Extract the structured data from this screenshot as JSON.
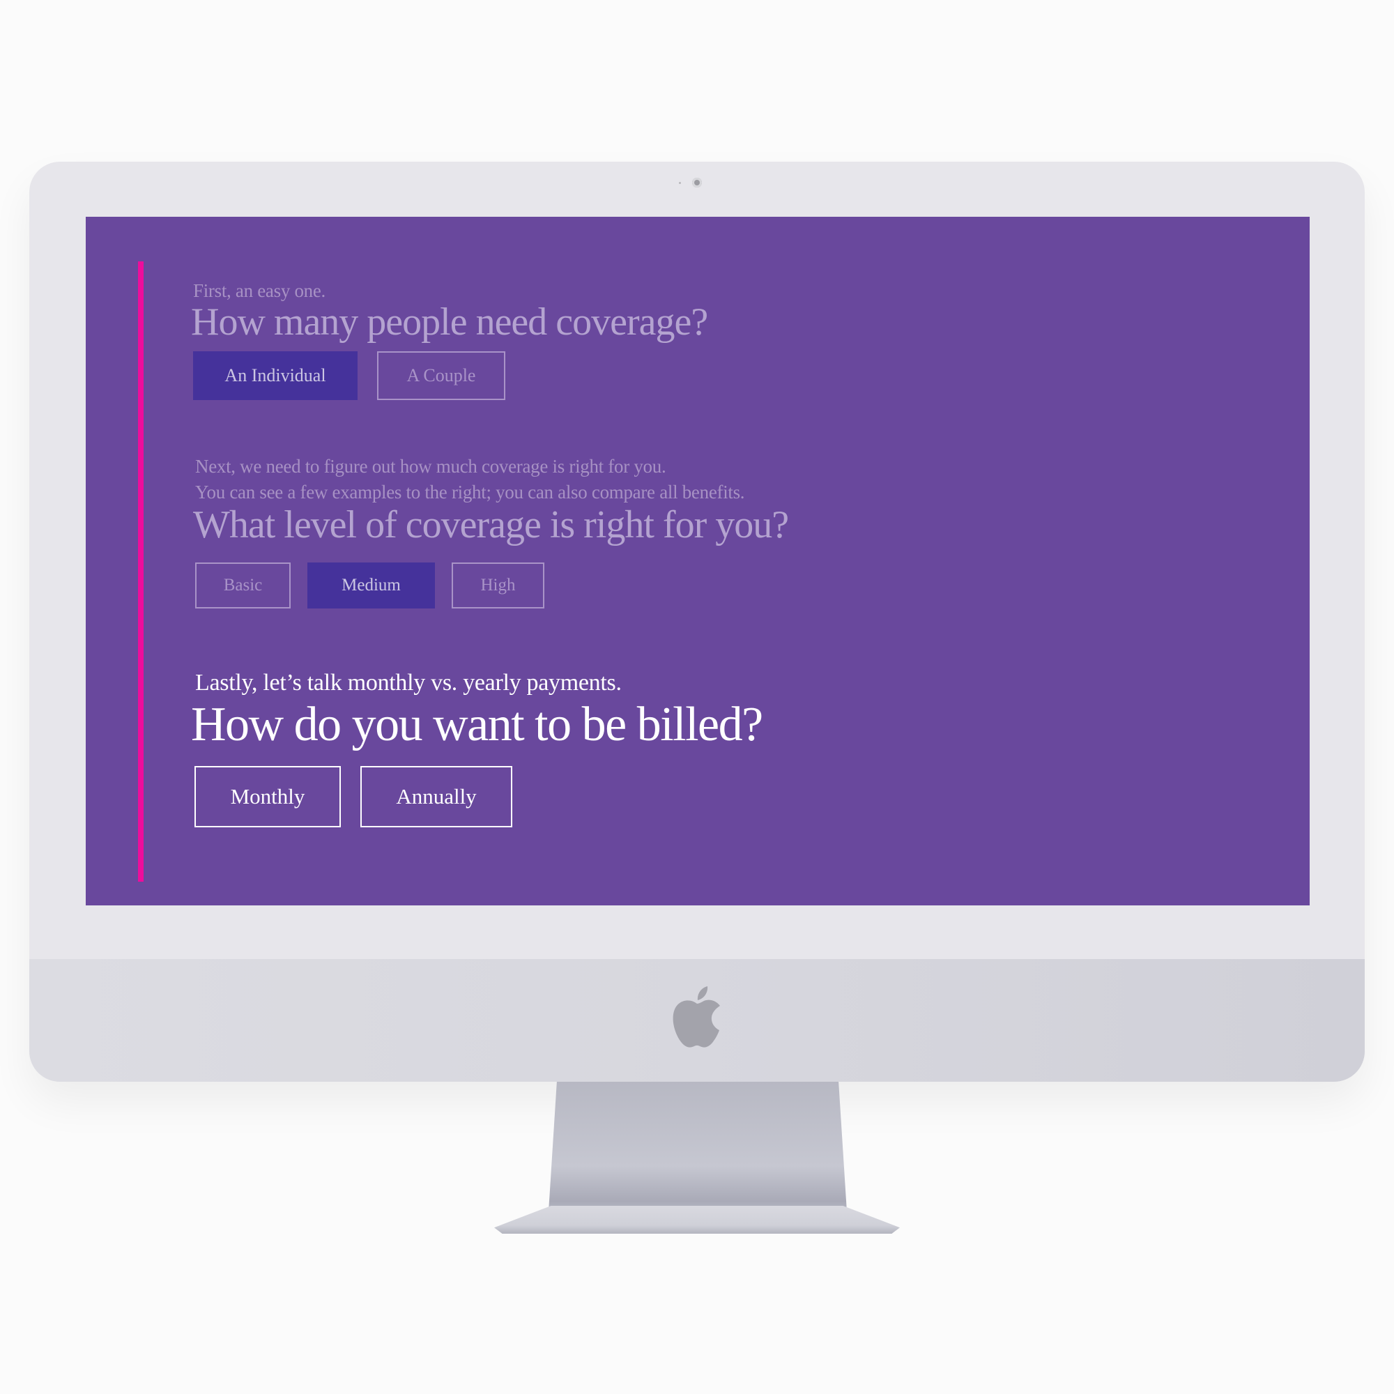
{
  "colors": {
    "screen_background": "#69489d",
    "progress_rail": "#ed0d9c",
    "selected_button": "#45329b",
    "active_text": "#ffffff"
  },
  "questions": [
    {
      "intro": "First, an easy one.",
      "title": "How many people need coverage?",
      "state": "answered",
      "options": [
        {
          "label": "An Individual",
          "selected": true
        },
        {
          "label": "A Couple",
          "selected": false
        }
      ]
    },
    {
      "intro_lines": [
        "Next, we need to figure out how much coverage is right for you.",
        "You can see a few examples to the right; you can also compare all benefits."
      ],
      "title": "What level of coverage is right for you?",
      "state": "answered",
      "options": [
        {
          "label": "Basic",
          "selected": false
        },
        {
          "label": "Medium",
          "selected": true
        },
        {
          "label": "High",
          "selected": false
        }
      ]
    },
    {
      "intro": "Lastly, let’s talk monthly vs. yearly payments.",
      "title": "How do you want to be billed?",
      "state": "active",
      "options": [
        {
          "label": "Monthly",
          "selected": false
        },
        {
          "label": "Annually",
          "selected": false
        }
      ]
    }
  ],
  "device": {
    "icons": [
      "camera-icon",
      "apple-logo-icon"
    ]
  }
}
